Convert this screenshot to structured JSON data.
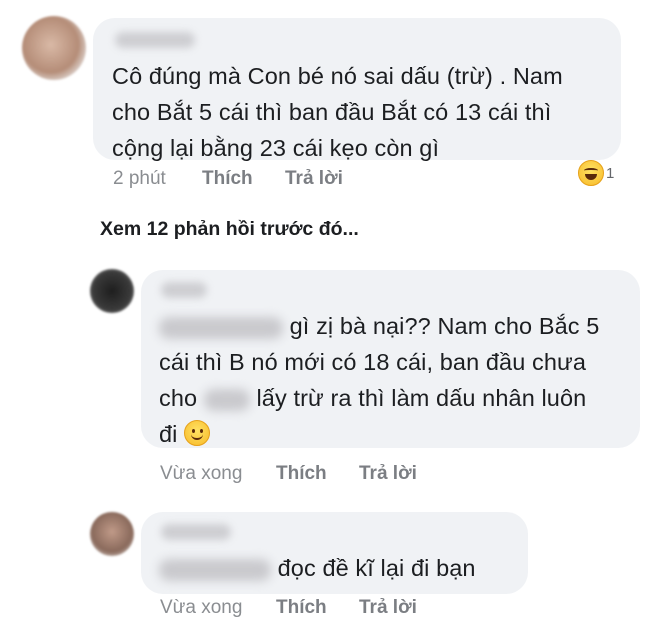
{
  "comment1": {
    "lines": [
      "Cô đúng mà Con bé nó sai dấu (trừ) . Nam",
      "cho Bắt 5 cái thì ban đầu Bắt có 13 cái thì",
      "cộng lại bằng 23 cái kẹo còn gì"
    ],
    "time": "2 phút",
    "like": "Thích",
    "reply": "Trả lời",
    "reaction": {
      "icon": "laugh-reaction-icon",
      "count": "1"
    }
  },
  "view_more": "Xem 12 phản hồi trước đó...",
  "reply1": {
    "lines": [
      "gì zị bà nại?? Nam cho Bắc 5",
      "cái thì B nó mới có 18 cái, ban đầu chưa",
      "lấy trừ ra thì làm dấu nhân luôn",
      "đi"
    ],
    "line3_prefix": "cho",
    "time": "Vừa xong",
    "like": "Thích",
    "reply": "Trả lời"
  },
  "reply2": {
    "text": "đọc đề kĩ lại đi bạn",
    "time": "Vừa xong",
    "like": "Thích",
    "reply": "Trả lời"
  }
}
